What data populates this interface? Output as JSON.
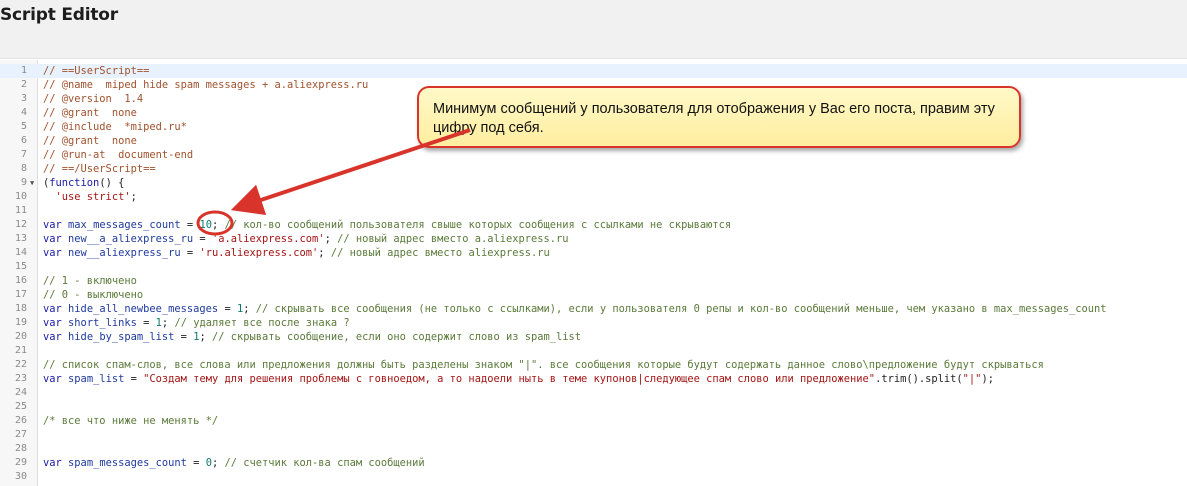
{
  "header": {
    "title": "Script Editor"
  },
  "callout": {
    "text": "Минимум сообщений у пользователя для отображения у Вас его поста, правим эту цифру под себя."
  },
  "lines": [
    {
      "n": "1",
      "tokens": [
        {
          "c": "cm",
          "t": "// ==UserScript=="
        }
      ]
    },
    {
      "n": "2",
      "tokens": [
        {
          "c": "cm",
          "t": "// @name  miped hide spam messages + a.aliexpress.ru"
        }
      ]
    },
    {
      "n": "3",
      "tokens": [
        {
          "c": "cm",
          "t": "// @version  1.4"
        }
      ]
    },
    {
      "n": "4",
      "tokens": [
        {
          "c": "cm",
          "t": "// @grant  none"
        }
      ]
    },
    {
      "n": "5",
      "tokens": [
        {
          "c": "cm",
          "t": "// @include  *miped.ru*"
        }
      ]
    },
    {
      "n": "6",
      "tokens": [
        {
          "c": "cm",
          "t": "// @grant  none"
        }
      ]
    },
    {
      "n": "7",
      "tokens": [
        {
          "c": "cm",
          "t": "// @run-at  document-end"
        }
      ]
    },
    {
      "n": "8",
      "tokens": [
        {
          "c": "cm",
          "t": "// ==/UserScript=="
        }
      ]
    },
    {
      "n": "9",
      "fold": true,
      "tokens": [
        {
          "c": "pl",
          "t": "("
        },
        {
          "c": "kw",
          "t": "function"
        },
        {
          "c": "pl",
          "t": "() {"
        }
      ]
    },
    {
      "n": "10",
      "tokens": [
        {
          "c": "pl",
          "t": "  "
        },
        {
          "c": "str",
          "t": "'use strict'"
        },
        {
          "c": "pl",
          "t": ";"
        }
      ]
    },
    {
      "n": "11",
      "tokens": []
    },
    {
      "n": "12",
      "tokens": [
        {
          "c": "kw",
          "t": "var"
        },
        {
          "c": "pl",
          "t": " "
        },
        {
          "c": "vr",
          "t": "max_messages_count"
        },
        {
          "c": "pl",
          "t": " = "
        },
        {
          "c": "num",
          "t": "10"
        },
        {
          "c": "pl",
          "t": "; "
        },
        {
          "c": "cm2",
          "t": "// кол-во сообщений пользователя свыше которых сообщения с ссылками не скрываются"
        }
      ]
    },
    {
      "n": "13",
      "tokens": [
        {
          "c": "kw",
          "t": "var"
        },
        {
          "c": "pl",
          "t": " "
        },
        {
          "c": "vr",
          "t": "new__a_aliexpress_ru"
        },
        {
          "c": "pl",
          "t": " = "
        },
        {
          "c": "str",
          "t": "'a.aliexpress.com'"
        },
        {
          "c": "pl",
          "t": "; "
        },
        {
          "c": "cm2",
          "t": "// новый адрес вместо a.aliexpress.ru"
        }
      ]
    },
    {
      "n": "14",
      "tokens": [
        {
          "c": "kw",
          "t": "var"
        },
        {
          "c": "pl",
          "t": " "
        },
        {
          "c": "vr",
          "t": "new__aliexpress_ru"
        },
        {
          "c": "pl",
          "t": " = "
        },
        {
          "c": "str",
          "t": "'ru.aliexpress.com'"
        },
        {
          "c": "pl",
          "t": "; "
        },
        {
          "c": "cm2",
          "t": "// новый адрес вместо aliexpress.ru"
        }
      ]
    },
    {
      "n": "15",
      "tokens": []
    },
    {
      "n": "16",
      "tokens": [
        {
          "c": "cm2",
          "t": "// 1 - включено"
        }
      ]
    },
    {
      "n": "17",
      "tokens": [
        {
          "c": "cm2",
          "t": "// 0 - выключено"
        }
      ]
    },
    {
      "n": "18",
      "tokens": [
        {
          "c": "kw",
          "t": "var"
        },
        {
          "c": "pl",
          "t": " "
        },
        {
          "c": "vr",
          "t": "hide_all_newbee_messages"
        },
        {
          "c": "pl",
          "t": " = "
        },
        {
          "c": "num",
          "t": "1"
        },
        {
          "c": "pl",
          "t": "; "
        },
        {
          "c": "cm2",
          "t": "// скрывать все сообщения (не только с ссылками), если у пользователя 0 репы и кол-во сообщений меньше, чем указано в max_messages_count"
        }
      ]
    },
    {
      "n": "19",
      "tokens": [
        {
          "c": "kw",
          "t": "var"
        },
        {
          "c": "pl",
          "t": " "
        },
        {
          "c": "vr",
          "t": "short_links"
        },
        {
          "c": "pl",
          "t": " = "
        },
        {
          "c": "num",
          "t": "1"
        },
        {
          "c": "pl",
          "t": "; "
        },
        {
          "c": "cm2",
          "t": "// удаляет все после знака ?"
        }
      ]
    },
    {
      "n": "20",
      "tokens": [
        {
          "c": "kw",
          "t": "var"
        },
        {
          "c": "pl",
          "t": " "
        },
        {
          "c": "vr",
          "t": "hide_by_spam_list"
        },
        {
          "c": "pl",
          "t": " = "
        },
        {
          "c": "num",
          "t": "1"
        },
        {
          "c": "pl",
          "t": "; "
        },
        {
          "c": "cm2",
          "t": "// скрывать сообщение, если оно содержит слово из spam_list"
        }
      ]
    },
    {
      "n": "21",
      "tokens": []
    },
    {
      "n": "22",
      "tokens": [
        {
          "c": "cm2",
          "t": "// список спам-слов, все слова или предложения должны быть разделены знаком \"|\". все сообщения которые будут содержать данное слово\\предложение будут скрываться"
        }
      ]
    },
    {
      "n": "23",
      "tokens": [
        {
          "c": "kw",
          "t": "var"
        },
        {
          "c": "pl",
          "t": " "
        },
        {
          "c": "vr",
          "t": "spam_list"
        },
        {
          "c": "pl",
          "t": " = "
        },
        {
          "c": "str",
          "t": "\"Создам тему для решения проблемы с говноедом, а то надоели ныть в теме купонов|следующее спам слово или предложение\""
        },
        {
          "c": "pl",
          "t": ".trim().split("
        },
        {
          "c": "str",
          "t": "\"|\""
        },
        {
          "c": "pl",
          "t": ");"
        }
      ]
    },
    {
      "n": "24",
      "tokens": []
    },
    {
      "n": "25",
      "tokens": []
    },
    {
      "n": "26",
      "tokens": [
        {
          "c": "cm2",
          "t": "/* все что ниже не менять */"
        }
      ]
    },
    {
      "n": "27",
      "tokens": []
    },
    {
      "n": "28",
      "tokens": []
    },
    {
      "n": "29",
      "tokens": [
        {
          "c": "kw",
          "t": "var"
        },
        {
          "c": "pl",
          "t": " "
        },
        {
          "c": "vr",
          "t": "spam_messages_count"
        },
        {
          "c": "pl",
          "t": " = "
        },
        {
          "c": "num",
          "t": "0"
        },
        {
          "c": "pl",
          "t": "; "
        },
        {
          "c": "cm2",
          "t": "// счетчик кол-ва спам сообщений"
        }
      ]
    },
    {
      "n": "30",
      "tokens": []
    }
  ],
  "colors": {
    "annotation": "#d9342b",
    "callout_fill": "#fff4b0"
  }
}
